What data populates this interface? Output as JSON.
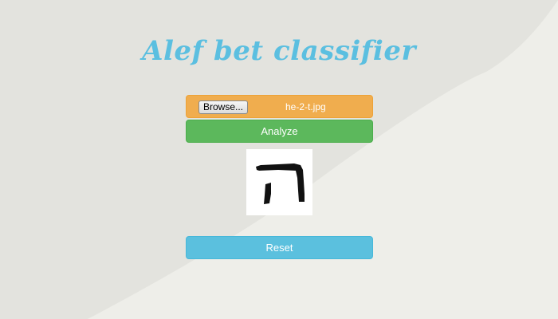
{
  "header": {
    "title": "Alef bet classifier"
  },
  "upload": {
    "browse_label": "Browse...",
    "file_name": "he-2-t.jpg"
  },
  "actions": {
    "analyze_label": "Analyze",
    "reset_label": "Reset"
  },
  "preview": {
    "depicts": "hebrew-letter-he"
  },
  "colors": {
    "title": "#5bbfe0",
    "upload_bar": "#f0ad4e",
    "analyze": "#5cb85c",
    "reset": "#5bc0de",
    "background": "#eaeae5"
  }
}
